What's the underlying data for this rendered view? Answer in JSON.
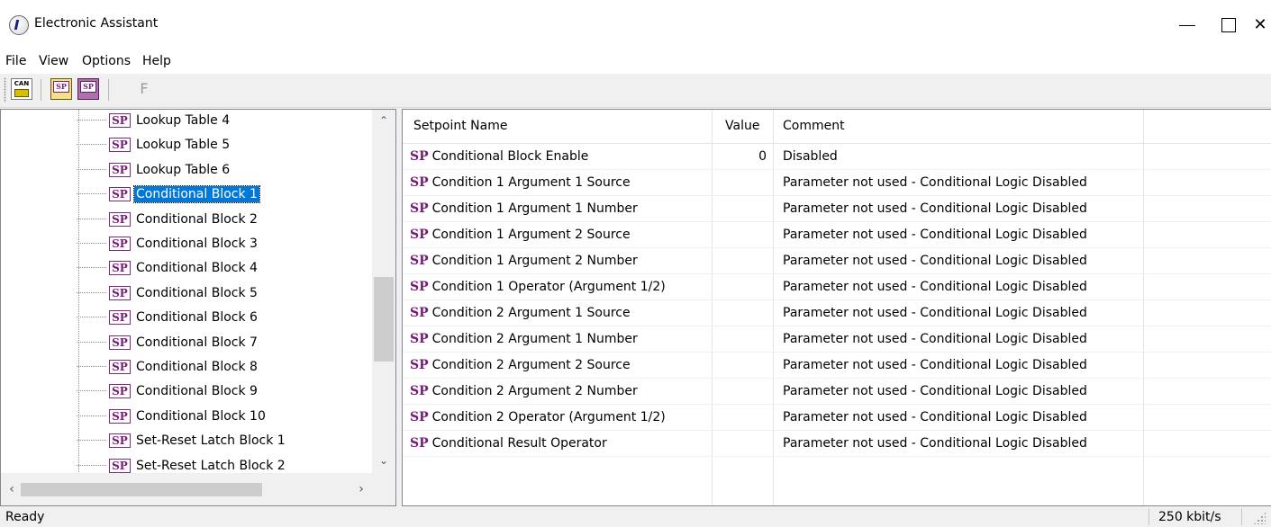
{
  "window": {
    "title": "Electronic Assistant"
  },
  "menu": [
    "File",
    "View",
    "Options",
    "Help"
  ],
  "toolbar": {
    "can_icon_text": "CAN",
    "f_label": "F"
  },
  "tree": {
    "badge": "SP",
    "items": [
      {
        "label": "Lookup Table 4",
        "selected": false
      },
      {
        "label": "Lookup Table 5",
        "selected": false
      },
      {
        "label": "Lookup Table 6",
        "selected": false
      },
      {
        "label": "Conditional Block 1",
        "selected": true
      },
      {
        "label": "Conditional Block 2",
        "selected": false
      },
      {
        "label": "Conditional Block 3",
        "selected": false
      },
      {
        "label": "Conditional Block 4",
        "selected": false
      },
      {
        "label": "Conditional Block 5",
        "selected": false
      },
      {
        "label": "Conditional Block 6",
        "selected": false
      },
      {
        "label": "Conditional Block 7",
        "selected": false
      },
      {
        "label": "Conditional Block 8",
        "selected": false
      },
      {
        "label": "Conditional Block 9",
        "selected": false
      },
      {
        "label": "Conditional Block 10",
        "selected": false
      },
      {
        "label": "Set-Reset Latch Block 1",
        "selected": false
      },
      {
        "label": "Set-Reset Latch Block 2",
        "selected": false
      }
    ]
  },
  "list": {
    "columns": [
      "Setpoint Name",
      "Value",
      "Comment"
    ],
    "prefix": "SP",
    "rows": [
      {
        "name": "Conditional Block Enable",
        "value": "0",
        "comment": "Disabled"
      },
      {
        "name": "Condition 1 Argument 1 Source",
        "value": "",
        "comment": "Parameter not used - Conditional Logic Disabled"
      },
      {
        "name": "Condition 1 Argument 1 Number",
        "value": "",
        "comment": "Parameter not used - Conditional Logic Disabled"
      },
      {
        "name": "Condition 1 Argument 2 Source",
        "value": "",
        "comment": "Parameter not used - Conditional Logic Disabled"
      },
      {
        "name": "Condition 1 Argument 2 Number",
        "value": "",
        "comment": "Parameter not used - Conditional Logic Disabled"
      },
      {
        "name": "Condition 1 Operator (Argument 1/2)",
        "value": "",
        "comment": "Parameter not used - Conditional Logic Disabled"
      },
      {
        "name": "Condition 2 Argument 1 Source",
        "value": "",
        "comment": "Parameter not used - Conditional Logic Disabled"
      },
      {
        "name": "Condition 2 Argument 1 Number",
        "value": "",
        "comment": "Parameter not used - Conditional Logic Disabled"
      },
      {
        "name": "Condition 2 Argument 2 Source",
        "value": "",
        "comment": "Parameter not used - Conditional Logic Disabled"
      },
      {
        "name": "Condition 2 Argument 2 Number",
        "value": "",
        "comment": "Parameter not used - Conditional Logic Disabled"
      },
      {
        "name": "Condition 2 Operator (Argument 1/2)",
        "value": "",
        "comment": "Parameter not used - Conditional Logic Disabled"
      },
      {
        "name": "Conditional Result Operator",
        "value": "",
        "comment": "Parameter not used - Conditional Logic Disabled"
      }
    ]
  },
  "status": {
    "left": "Ready",
    "rate": "250 kbit/s"
  },
  "colors": {
    "selection": "#0078d7",
    "sp_purple": "#7a1a7a"
  }
}
